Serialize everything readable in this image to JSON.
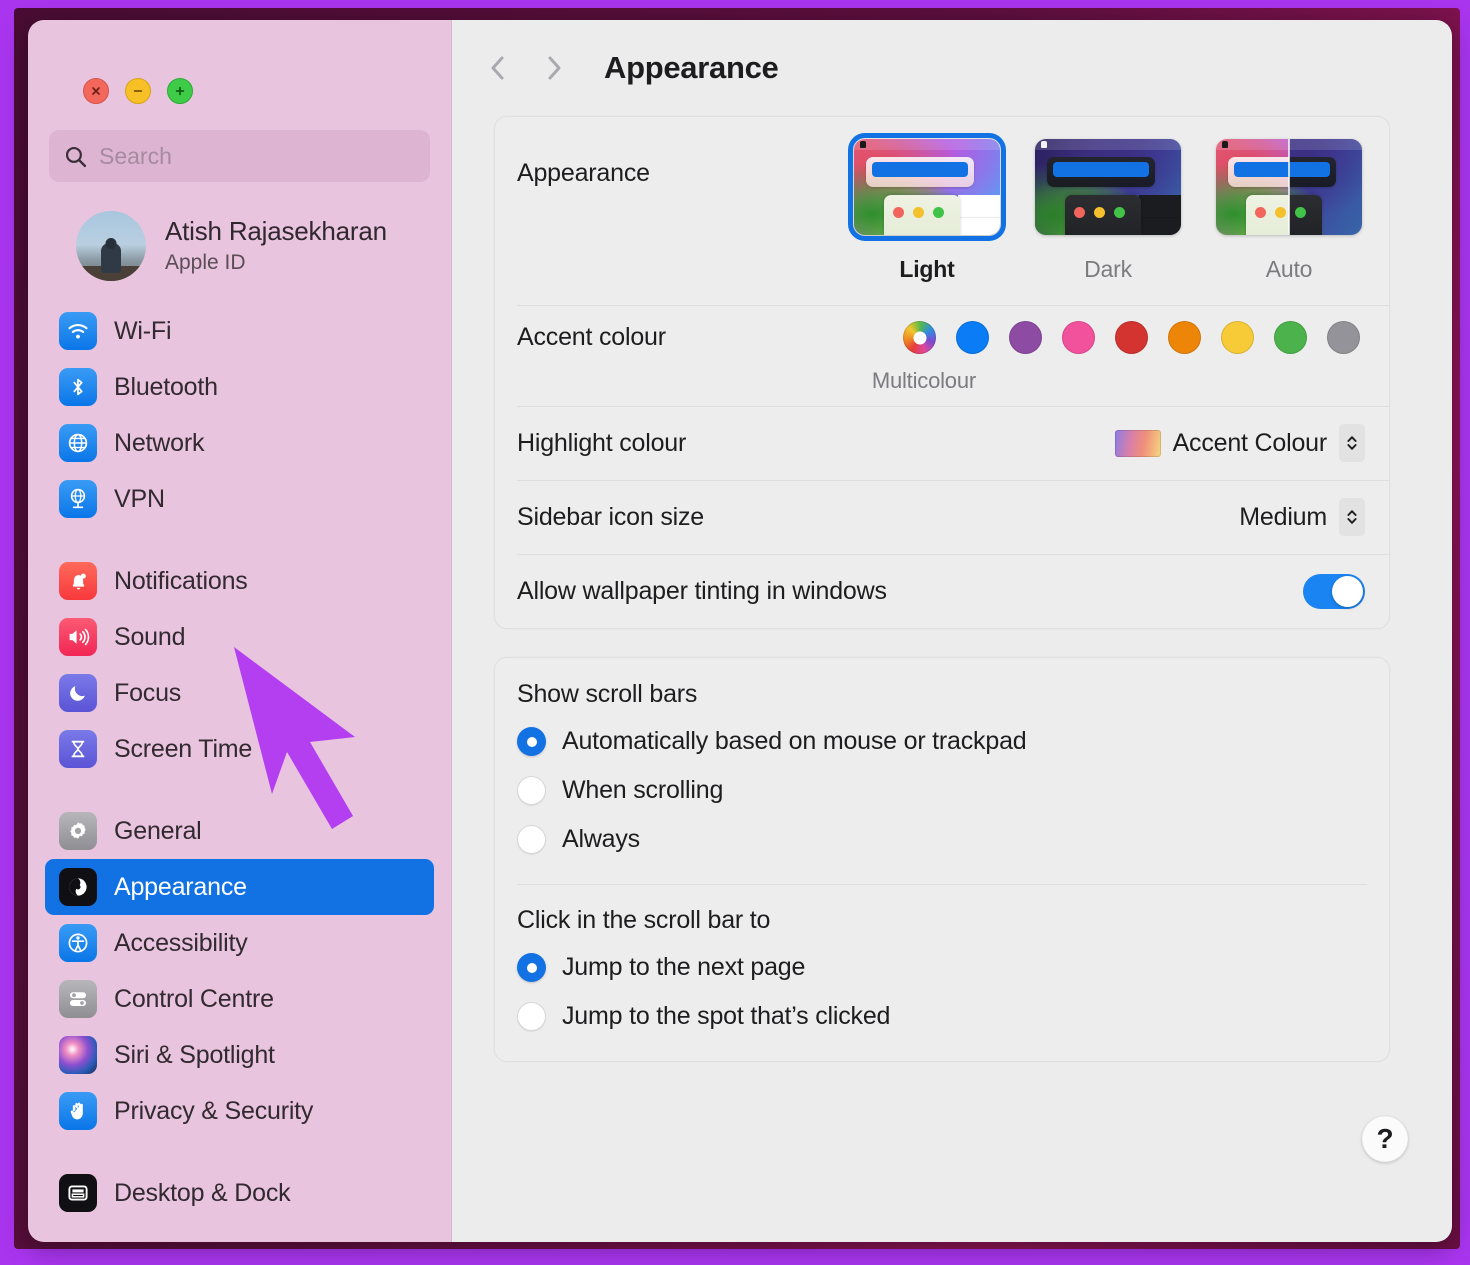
{
  "window": {
    "traffic_lights": [
      {
        "name": "close",
        "glyph": "close-icon"
      },
      {
        "name": "minimise",
        "glyph": "minimise-icon"
      },
      {
        "name": "maximise",
        "glyph": "maximise-icon"
      }
    ]
  },
  "sidebar": {
    "search": {
      "placeholder": "Search",
      "value": "",
      "icon": "search-icon"
    },
    "account": {
      "name": "Atish Rajasekharan",
      "subtitle": "Apple ID",
      "avatar": "user-avatar"
    },
    "groups": [
      {
        "items": [
          {
            "label": "Wi-Fi",
            "icon": "wifi-icon",
            "selected": false
          },
          {
            "label": "Bluetooth",
            "icon": "bluetooth-icon",
            "selected": false
          },
          {
            "label": "Network",
            "icon": "network-icon",
            "selected": false
          },
          {
            "label": "VPN",
            "icon": "vpn-icon",
            "selected": false
          }
        ]
      },
      {
        "items": [
          {
            "label": "Notifications",
            "icon": "notifications-icon",
            "selected": false
          },
          {
            "label": "Sound",
            "icon": "sound-icon",
            "selected": false
          },
          {
            "label": "Focus",
            "icon": "focus-icon",
            "selected": false
          },
          {
            "label": "Screen Time",
            "icon": "screen-time-icon",
            "selected": false
          }
        ]
      },
      {
        "items": [
          {
            "label": "General",
            "icon": "gear-icon",
            "selected": false
          },
          {
            "label": "Appearance",
            "icon": "appearance-icon",
            "selected": true
          },
          {
            "label": "Accessibility",
            "icon": "accessibility-icon",
            "selected": false
          },
          {
            "label": "Control Centre",
            "icon": "control-centre-icon",
            "selected": false
          },
          {
            "label": "Siri & Spotlight",
            "icon": "siri-icon",
            "selected": false
          },
          {
            "label": "Privacy & Security",
            "icon": "privacy-icon",
            "selected": false
          }
        ]
      },
      {
        "items": [
          {
            "label": "Desktop & Dock",
            "icon": "desktop-dock-icon",
            "selected": false
          }
        ]
      }
    ]
  },
  "main": {
    "title": "Appearance",
    "nav": {
      "back": "chevron-left-icon",
      "forward": "chevron-right-icon"
    },
    "appearance": {
      "label": "Appearance",
      "options": [
        {
          "name": "Light",
          "selected": true
        },
        {
          "name": "Dark",
          "selected": false
        },
        {
          "name": "Auto",
          "selected": false
        }
      ]
    },
    "accent": {
      "label": "Accent colour",
      "caption": "Multicolour",
      "selected": "Multicolour",
      "swatches": [
        {
          "name": "Multicolour",
          "colour": "multicolour",
          "selected": true
        },
        {
          "name": "Blue",
          "colour": "#0a7cf5",
          "selected": false
        },
        {
          "name": "Purple",
          "colour": "#8e4ba4",
          "selected": false
        },
        {
          "name": "Pink",
          "colour": "#f2519b",
          "selected": false
        },
        {
          "name": "Red",
          "colour": "#d4342f",
          "selected": false
        },
        {
          "name": "Orange",
          "colour": "#ed8509",
          "selected": false
        },
        {
          "name": "Yellow",
          "colour": "#f7cb38",
          "selected": false
        },
        {
          "name": "Green",
          "colour": "#4cb34c",
          "selected": false
        },
        {
          "name": "Graphite",
          "colour": "#939399",
          "selected": false
        }
      ]
    },
    "highlight": {
      "label": "Highlight colour",
      "value": "Accent Colour"
    },
    "sidebar_icon_size": {
      "label": "Sidebar icon size",
      "value": "Medium"
    },
    "wallpaper_tinting": {
      "label": "Allow wallpaper tinting in windows",
      "on": true
    },
    "show_scroll_bars": {
      "title": "Show scroll bars",
      "options": [
        {
          "label": "Automatically based on mouse or trackpad",
          "selected": true
        },
        {
          "label": "When scrolling",
          "selected": false
        },
        {
          "label": "Always",
          "selected": false
        }
      ]
    },
    "click_scroll_bar": {
      "title": "Click in the scroll bar to",
      "options": [
        {
          "label": "Jump to the next page",
          "selected": true
        },
        {
          "label": "Jump to the spot that’s clicked",
          "selected": false
        }
      ]
    },
    "help": {
      "label": "?"
    }
  },
  "annotation": {
    "type": "arrow-pointer",
    "colour": "#b43ff0",
    "points_at": "Notifications"
  },
  "colours": {
    "accent": "#1272e4",
    "sidebar_bg": "#e8c4de",
    "main_bg": "#ececec",
    "frame_outer": "#a935ef",
    "frame_mat": "#4d0a35"
  }
}
